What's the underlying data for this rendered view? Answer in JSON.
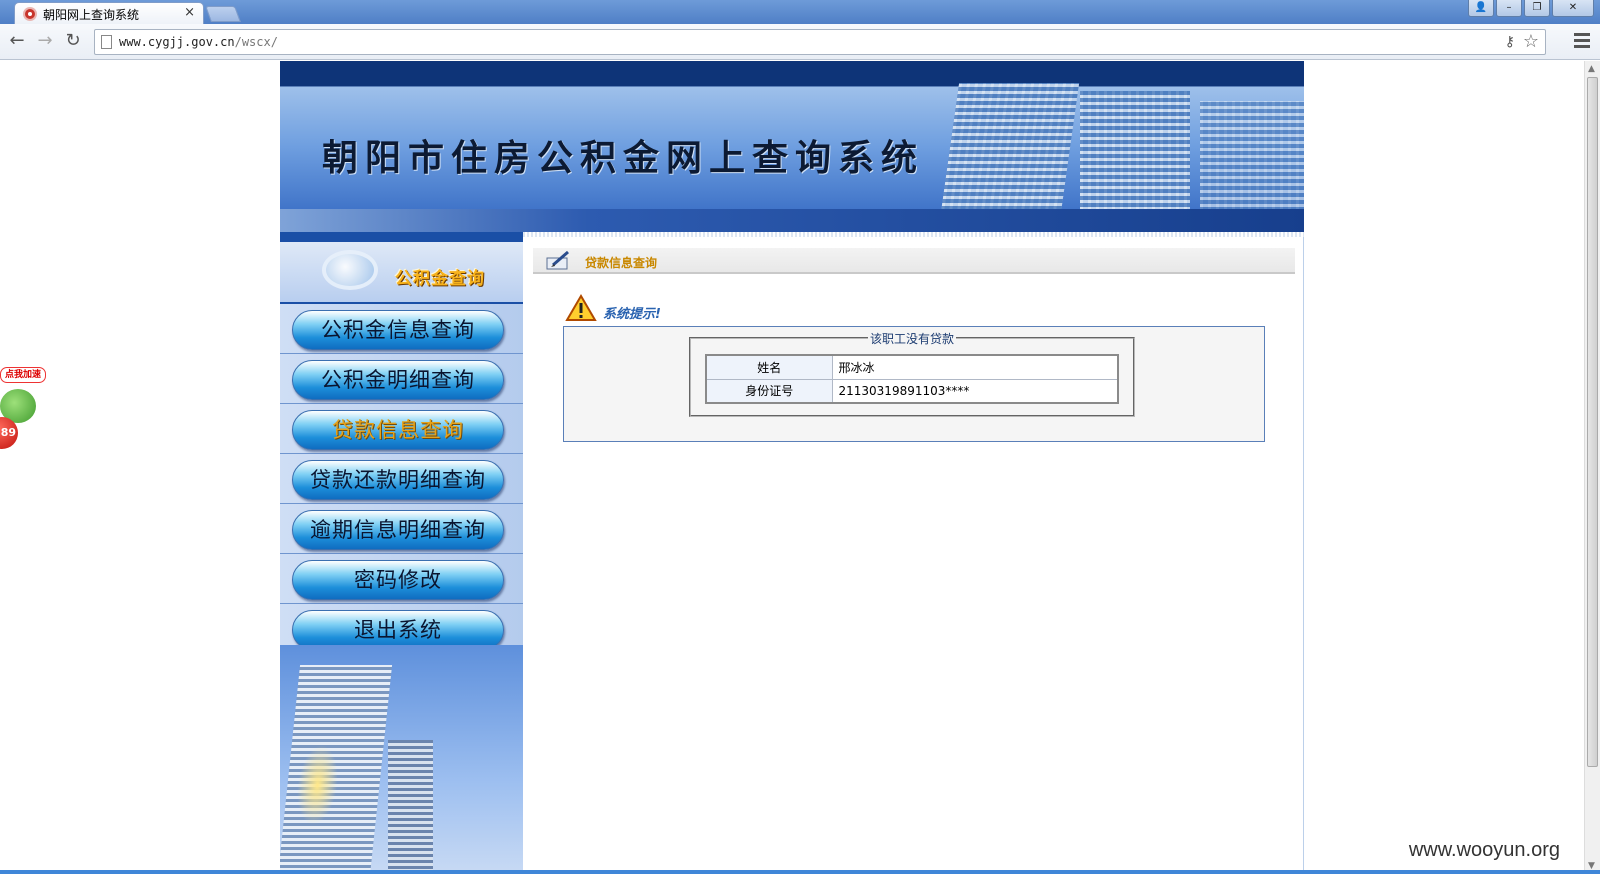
{
  "browser": {
    "tab_title": "朝阳网上查询系统",
    "tab_close": "×",
    "url_host": "www.cygjj.gov.cn",
    "url_path": "/wscx/",
    "window_buttons": [
      "👤",
      "–",
      "❐",
      "✕"
    ]
  },
  "site": {
    "banner_title": "朝阳市住房公积金网上查询系统",
    "sidebar_header": "公积金查询",
    "menu": [
      {
        "label": "公积金信息查询",
        "active": false
      },
      {
        "label": "公积金明细查询",
        "active": false
      },
      {
        "label": "贷款信息查询",
        "active": true
      },
      {
        "label": "贷款还款明细查询",
        "active": false
      },
      {
        "label": "逾期信息明细查询",
        "active": false
      },
      {
        "label": "密码修改",
        "active": false
      },
      {
        "label": "退出系统",
        "active": false
      }
    ],
    "section_title": "贷款信息查询",
    "notice_title": "系统提示!",
    "notice_legend": "该职工没有贷款",
    "info": {
      "name_label": "姓名",
      "name_value": "邢冰冰",
      "id_label": "身份证号",
      "id_value": "21130319891103****"
    }
  },
  "widget": {
    "bubble": "点我加速",
    "count": "89"
  },
  "watermark": "www.wooyun.org",
  "colors": {
    "banner_dark": "#0e3478",
    "active_menu_text": "#e6a21a",
    "section_title": "#c98800",
    "notice_title": "#2a63b0"
  }
}
